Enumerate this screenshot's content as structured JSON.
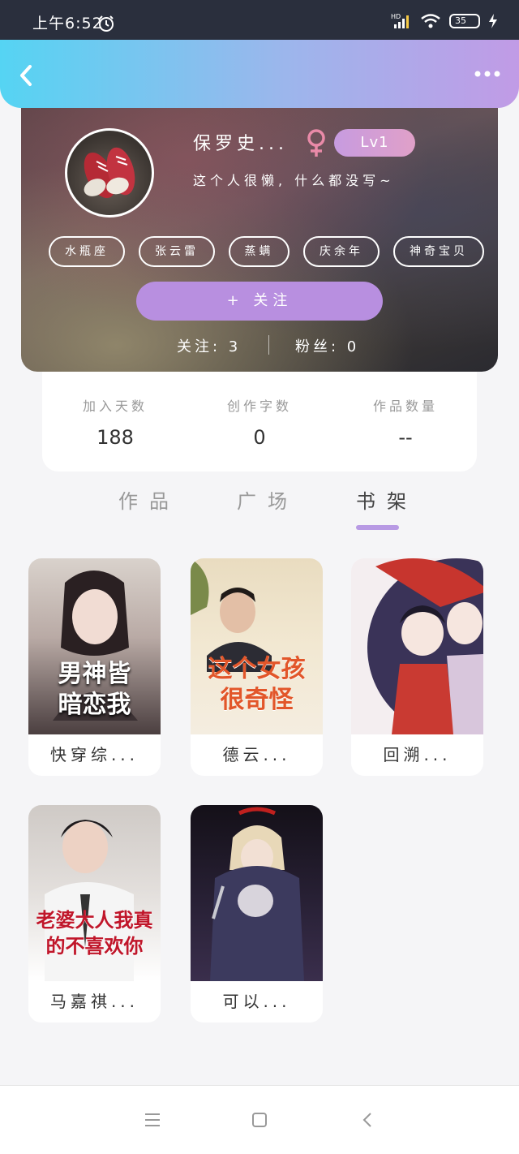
{
  "status_bar": {
    "time": "上午6:52",
    "battery": "35",
    "network_label": "HD"
  },
  "profile": {
    "username": "保罗史...",
    "level": "Lv1",
    "bio": "这个人很懒, 什么都没写~",
    "tags": [
      "水瓶座",
      "张云雷",
      "蒸螨",
      "庆余年",
      "神奇宝贝"
    ],
    "follow_label": "+  关注",
    "following_text": "关注: 3",
    "fans_text": "粉丝: 0"
  },
  "stats": [
    {
      "label": "加入天数",
      "value": "188"
    },
    {
      "label": "创作字数",
      "value": "0"
    },
    {
      "label": "作品数量",
      "value": "--"
    }
  ],
  "tabs": [
    {
      "label": "作品",
      "active": false
    },
    {
      "label": "广场",
      "active": false
    },
    {
      "label": "书架",
      "active": true
    }
  ],
  "books": [
    {
      "title": "快穿综...",
      "cover_text": "男神皆\n暗恋我"
    },
    {
      "title": "德云...",
      "cover_text": "这个女孩\n很奇怪"
    },
    {
      "title": "回溯...",
      "cover_text": ""
    },
    {
      "title": "马嘉祺...",
      "cover_text": "老婆大人我真\n的不喜欢你"
    },
    {
      "title": "可以...",
      "cover_text": ""
    }
  ],
  "colors": {
    "accent": "#b88fe0",
    "header_start": "#55d4f3",
    "header_end": "#c19be6"
  },
  "icons": [
    "back-icon",
    "more-icon",
    "alarm-icon",
    "female-gender-icon",
    "menu-icon",
    "home-icon",
    "back-nav-icon"
  ]
}
